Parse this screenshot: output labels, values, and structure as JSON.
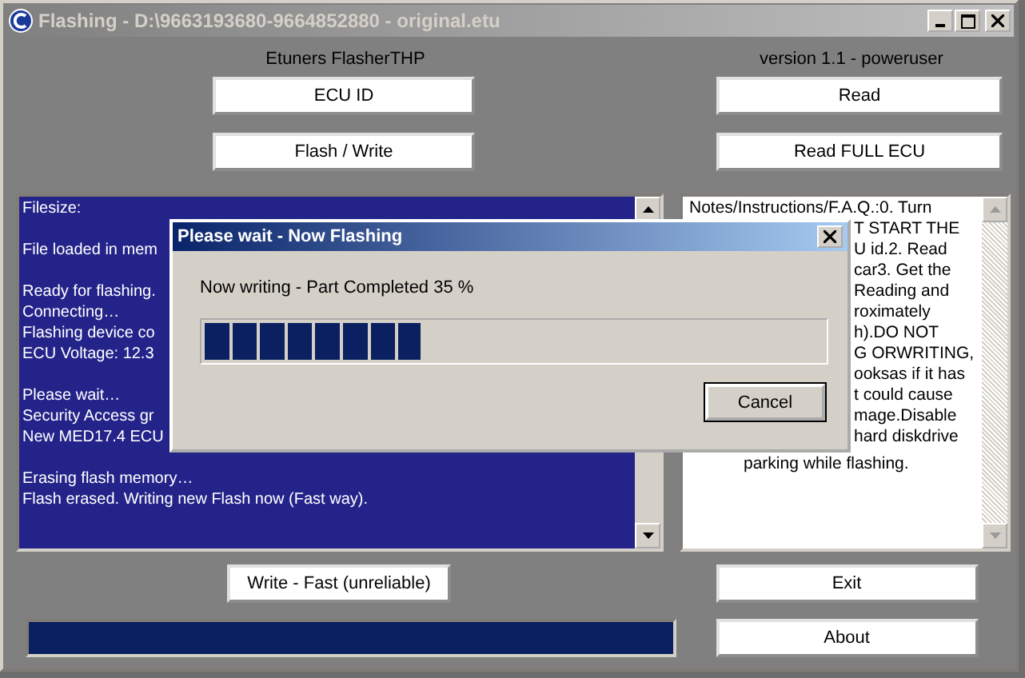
{
  "window": {
    "title": "Flashing - D:\\9663193680-9664852880 - original.etu"
  },
  "header": {
    "app_name": "Etuners FlasherTHP",
    "version": "version 1.1 - poweruser"
  },
  "buttons_left": [
    "ECU ID",
    "Flash / Write"
  ],
  "buttons_right": [
    "Read",
    "Read FULL ECU"
  ],
  "log": {
    "paragraphs": [
      [
        "Filesize:"
      ],
      [
        "File loaded in mem"
      ],
      [
        "Ready for flashing.",
        "Connecting…",
        "Flashing device co",
        "ECU Voltage: 12.3"
      ],
      [
        "Please wait…",
        "Security Access gr",
        "New MED17.4 ECU"
      ],
      [
        "Erasing flash memory…",
        "Flash erased. Writing new Flash now (Fast way)."
      ]
    ]
  },
  "notes": {
    "lines": [
      {
        "kind": "full",
        "text": "Notes/Instructions/F.A.Q.:0. Turn"
      },
      {
        "kind": "cut",
        "text": "T START THE"
      },
      {
        "kind": "cut",
        "text": "U id.2. Read"
      },
      {
        "kind": "cut",
        "text": "car3. Get the"
      },
      {
        "kind": "cut",
        "text": "Reading and"
      },
      {
        "kind": "cut",
        "text": "roximately"
      },
      {
        "kind": "cut",
        "text": "h).DO NOT"
      },
      {
        "kind": "cut",
        "text": "G ORWRITING,"
      },
      {
        "kind": "cut",
        "text": "ooksas if it has"
      },
      {
        "kind": "cut",
        "text": "t could cause"
      },
      {
        "kind": "cut",
        "text": "mage.Disable"
      },
      {
        "kind": "cut",
        "text": "hard diskdrive"
      },
      {
        "kind": "tail",
        "text": "parking while flashing."
      }
    ]
  },
  "write_fast_button": "Write - Fast (unreliable)",
  "overall_progress": {
    "level": 1
  },
  "exit_button": "Exit",
  "about_button": "About",
  "dialog": {
    "title": "Please wait - Now Flashing",
    "message": "Now writing - Part Completed 35 %",
    "progress": {
      "level": 0.35
    },
    "cancel_button": "Cancel"
  }
}
